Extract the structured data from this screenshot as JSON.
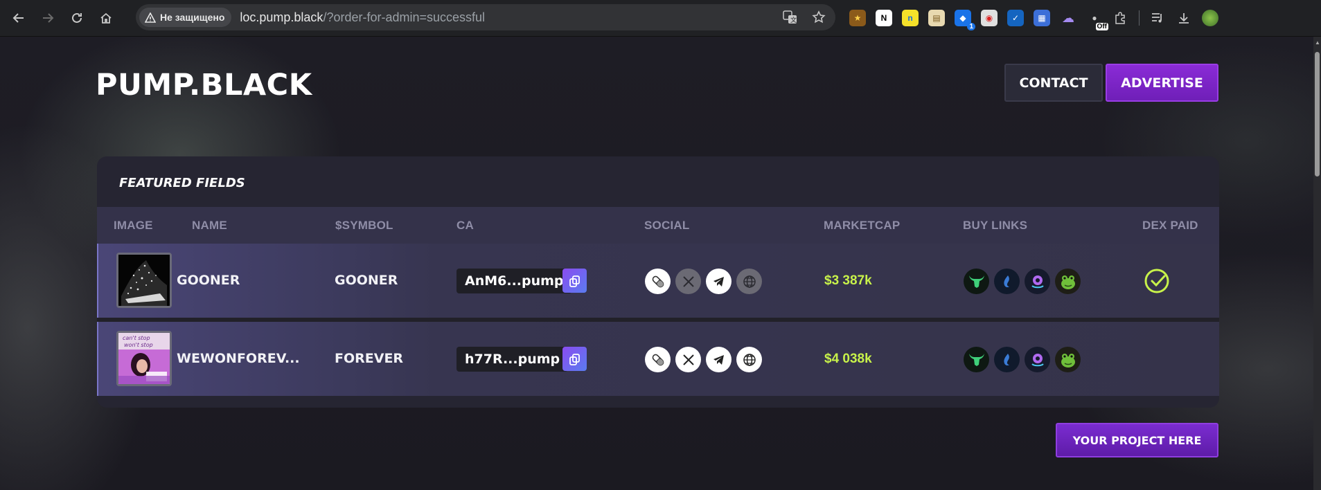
{
  "browser": {
    "security_label": "Не защищено",
    "url_host": "loc.pump.black",
    "url_path": "/?order-for-admin=successful",
    "ext_badge_count": "1",
    "ext_badge_off": "Off"
  },
  "header": {
    "logo": "PUMP.BLACK",
    "contact_label": "CONTACT",
    "advertise_label": "ADVERTISE"
  },
  "table": {
    "title": "FEATURED FIELDS",
    "columns": [
      "IMAGE",
      "NAME",
      "$SYMBOL",
      "CA",
      "SOCIAL",
      "MARKETCAP",
      "BUY LINKS",
      "DEX PAID"
    ],
    "rows": [
      {
        "name": "GOONER",
        "symbol": "GOONER",
        "ca": "AnM6...pump",
        "marketcap": "$3 387k",
        "socials_active": [
          true,
          false,
          true,
          false
        ],
        "dex_paid": true
      },
      {
        "name": "WEWONFOREV...",
        "symbol": "FOREVER",
        "ca": "h77R...pump",
        "marketcap": "$4 038k",
        "socials_active": [
          true,
          true,
          true,
          true
        ],
        "dex_paid": false
      }
    ]
  },
  "cta": {
    "label": "YOUR PROJECT HERE"
  },
  "colors": {
    "accent_purple": "#8a2bd6",
    "marketcap_green": "#c8f24a",
    "background": "#1c1b22"
  },
  "icons": {
    "social": [
      "pill-icon",
      "x-icon",
      "telegram-icon",
      "globe-icon"
    ],
    "buy_links": [
      "bull-icon",
      "photon-icon",
      "radar-icon",
      "frog-icon"
    ]
  }
}
